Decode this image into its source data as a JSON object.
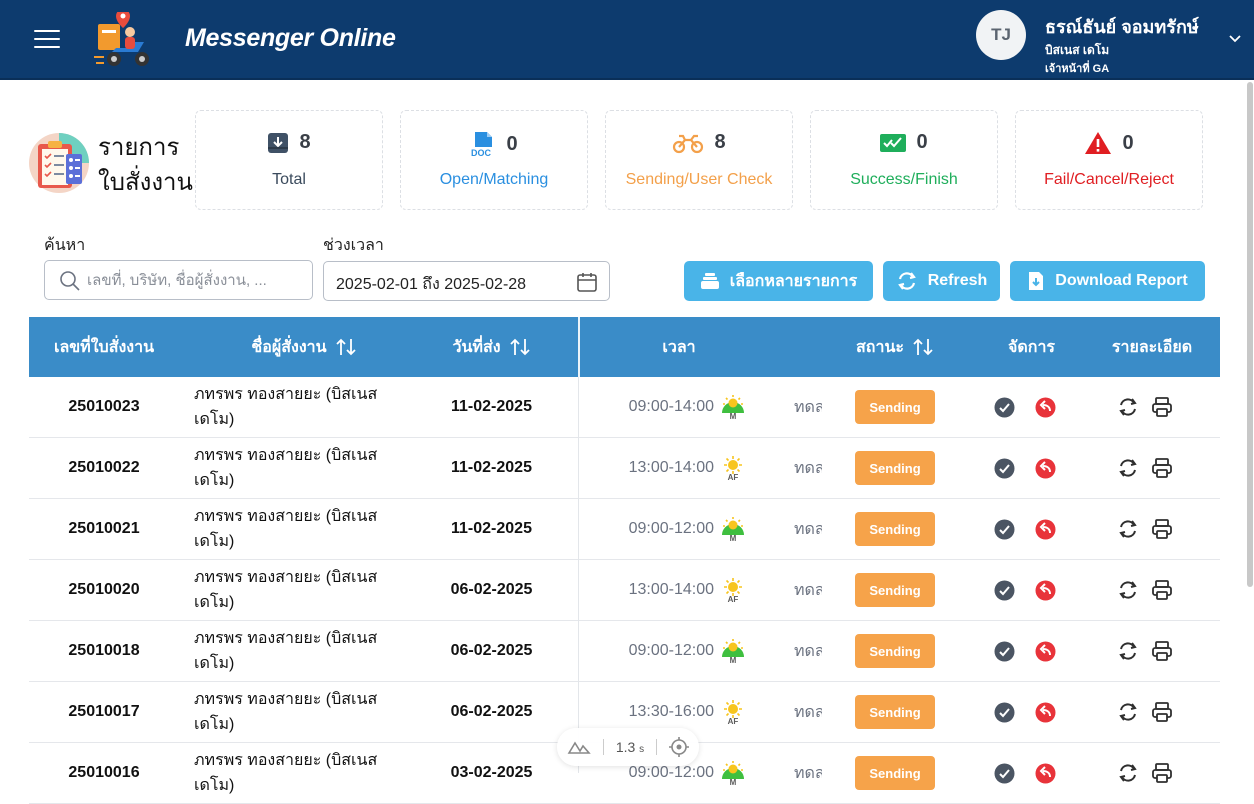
{
  "header": {
    "app_title": "Messenger Online",
    "user": {
      "initials": "TJ",
      "name": "ธรณ์ธันย์ จอมทรักษ์",
      "company": "บิสเนส เดโม",
      "role": "เจ้าหน้าที่ GA"
    }
  },
  "page": {
    "title_line1": "รายการ",
    "title_line2": "ใบสั่งงาน"
  },
  "summary_cards": [
    {
      "count": "8",
      "label": "Total",
      "color": "#3a4a5c",
      "icon": "inbox-download-icon"
    },
    {
      "count": "0",
      "label": "Open/Matching",
      "color": "#2a8fe0",
      "icon": "doc-icon"
    },
    {
      "count": "8",
      "label": "Sending/User Check",
      "color": "#f3a04a",
      "icon": "motorcycle-icon"
    },
    {
      "count": "0",
      "label": "Success/Finish",
      "color": "#1fae5b",
      "icon": "check-list-icon"
    },
    {
      "count": "0",
      "label": "Fail/Cancel/Reject",
      "color": "#e01e22",
      "icon": "warning-icon"
    }
  ],
  "filters": {
    "search_label": "ค้นหา",
    "search_placeholder": "เลขที่, บริษัท, ชื่อผู้สั่งงาน, ...",
    "date_label": "ช่วงเวลา",
    "date_value": "2025-02-01 ถึง 2025-02-28"
  },
  "actions": {
    "select_multiple": "เลือกหลายรายการ",
    "refresh": "Refresh",
    "download": "Download Report"
  },
  "table": {
    "headers": {
      "order_no": "เลขที่ใบสั่งงาน",
      "orderer": "ชื่อผู้สั่งงาน",
      "send_date": "วันที่ส่ง",
      "time": "เวลา",
      "status": "สถานะ",
      "manage": "จัดการ",
      "detail": "รายละเอียด"
    },
    "rows": [
      {
        "order_no": "25010023",
        "name": "ภทรพร ทองสายยะ (บิสเนส เดโม)",
        "date": "11-02-2025",
        "time": "09:00-14:00",
        "period": "M",
        "extra": "ทดสอบ",
        "status": "Sending"
      },
      {
        "order_no": "25010022",
        "name": "ภทรพร ทองสายยะ (บิสเนส เดโม)",
        "date": "11-02-2025",
        "time": "13:00-14:00",
        "period": "AF",
        "extra": "ทดสอบ",
        "status": "Sending"
      },
      {
        "order_no": "25010021",
        "name": "ภทรพร ทองสายยะ (บิสเนส เดโม)",
        "date": "11-02-2025",
        "time": "09:00-12:00",
        "period": "M",
        "extra": "ทดสอบ",
        "status": "Sending"
      },
      {
        "order_no": "25010020",
        "name": "ภทรพร ทองสายยะ (บิสเนส เดโม)",
        "date": "06-02-2025",
        "time": "13:00-14:00",
        "period": "AF",
        "extra": "ทดสอบ",
        "status": "Sending"
      },
      {
        "order_no": "25010018",
        "name": "ภทรพร ทองสายยะ (บิสเนส เดโม)",
        "date": "06-02-2025",
        "time": "09:00-12:00",
        "period": "M",
        "extra": "ทดสอบ",
        "status": "Sending"
      },
      {
        "order_no": "25010017",
        "name": "ภทรพร ทองสายยะ (บิสเนส เดโม)",
        "date": "06-02-2025",
        "time": "13:30-16:00",
        "period": "AF",
        "extra": "ทดสอบ",
        "status": "Sending"
      },
      {
        "order_no": "25010016",
        "name": "ภทรพร ทองสายยะ (บิสเนส เดโม)",
        "date": "03-02-2025",
        "time": "09:00-12:00",
        "period": "M",
        "extra": "ทดสอบ",
        "status": "Sending"
      }
    ]
  },
  "perf_overlay": {
    "value": "1.3",
    "unit": "s"
  }
}
